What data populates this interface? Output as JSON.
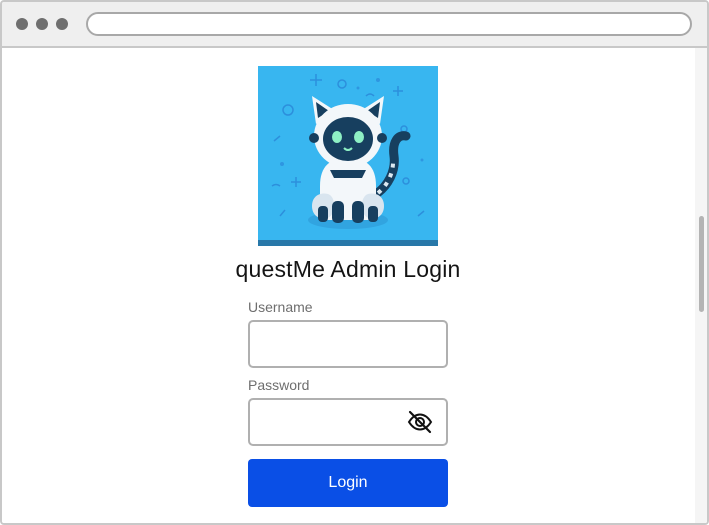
{
  "browser": {
    "window_controls": [
      "dot",
      "dot",
      "dot"
    ],
    "address_bar": ""
  },
  "page": {
    "logo_icon": "robot-cat-illustration",
    "title": "questMe Admin Login",
    "username": {
      "label": "Username",
      "value": "",
      "placeholder": ""
    },
    "password": {
      "label": "Password",
      "value": "",
      "placeholder": "",
      "visibility_icon": "eye-slash-icon"
    },
    "login_button": "Login"
  },
  "colors": {
    "accent": "#0a4fe6",
    "logo_background": "#38b6f0",
    "title_text": "#141414",
    "label_text": "#6e6e6e"
  }
}
